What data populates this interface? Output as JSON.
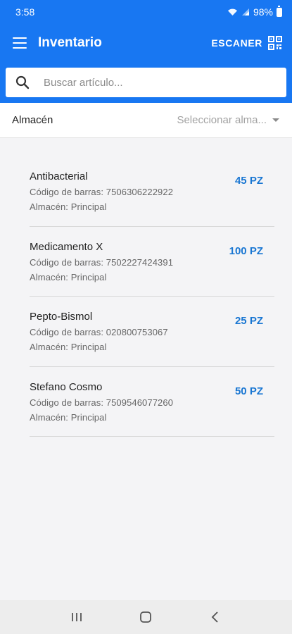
{
  "status": {
    "time": "3:58",
    "battery": "98%"
  },
  "appbar": {
    "title": "Inventario",
    "scan_label": "ESCANER"
  },
  "search": {
    "placeholder": "Buscar artículo..."
  },
  "warehouse": {
    "label": "Almacén",
    "select_placeholder": "Seleccionar alma..."
  },
  "items": [
    {
      "name": "Antibacterial",
      "barcode": "Código de barras: 7506306222922",
      "warehouse": "Almacén: Principal",
      "qty": "45 PZ"
    },
    {
      "name": "Medicamento X",
      "barcode": "Código de barras: 7502227424391",
      "warehouse": "Almacén: Principal",
      "qty": "100 PZ"
    },
    {
      "name": "Pepto-Bismol",
      "barcode": "Código de barras: 020800753067",
      "warehouse": "Almacén: Principal",
      "qty": "25 PZ"
    },
    {
      "name": "Stefano Cosmo",
      "barcode": "Código de barras: 7509546077260",
      "warehouse": "Almacén: Principal",
      "qty": "50 PZ"
    }
  ],
  "colors": {
    "primary": "#1877f2",
    "quantity": "#1976d2"
  },
  "icons": [
    "menu-icon",
    "qr-code-icon",
    "search-icon",
    "chevron-down-icon",
    "wifi-icon",
    "signal-icon",
    "battery-icon",
    "recent-apps-icon",
    "home-icon",
    "back-icon"
  ]
}
